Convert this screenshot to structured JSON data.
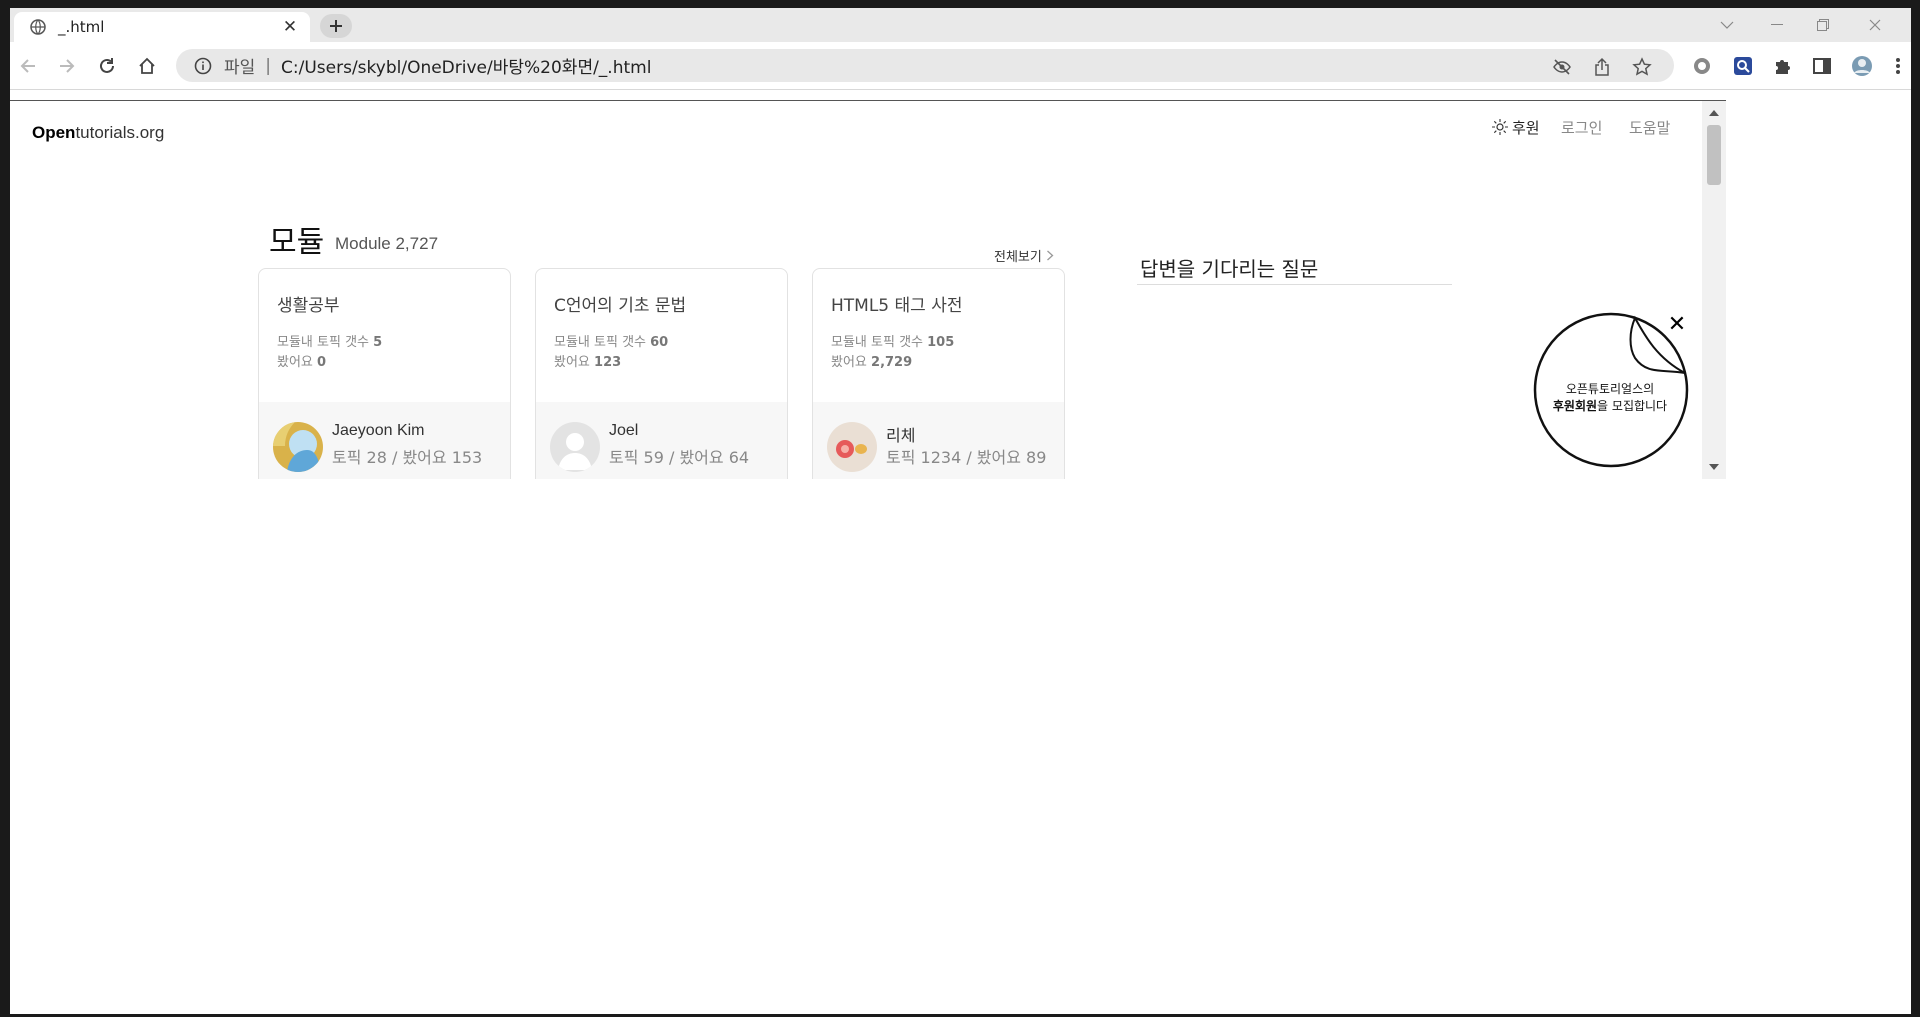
{
  "browser": {
    "tab_title": "_.html",
    "omnibox": {
      "scheme_label": "파일",
      "separator": "|",
      "url": "C:/Users/skybl/OneDrive/바탕%20화면/_.html"
    }
  },
  "page": {
    "logo": {
      "bold": "Open",
      "rest": "tutorials.org"
    },
    "nav": {
      "support": "후원",
      "login": "로그인",
      "help": "도움말"
    },
    "modules": {
      "title": "모듈",
      "subtitle": "Module 2,727",
      "view_all": "전체보기",
      "cards": [
        {
          "title": "생활공부",
          "topics_label": "모듈내 토픽 갯수",
          "topics": "5",
          "seen_label": "봤어요",
          "seen": "0",
          "author": "Jaeyoon Kim",
          "author_stats": "토픽 28 / 봤어요 153"
        },
        {
          "title": "C언어의 기초 문법",
          "topics_label": "모듈내 토픽 갯수",
          "topics": "60",
          "seen_label": "봤어요",
          "seen": "123",
          "author": "Joel",
          "author_stats": "토픽 59 / 봤어요 64"
        },
        {
          "title": "HTML5 태그 사전",
          "topics_label": "모듈내 토픽 갯수",
          "topics": "105",
          "seen_label": "봤어요",
          "seen": "2,729",
          "author": "리체",
          "author_stats": "토픽 1234 / 봤어요 89"
        }
      ]
    },
    "questions": {
      "title": "답변을 기다리는 질문"
    },
    "promo": {
      "line1": "오픈튜토리얼스의",
      "line2_bold": "후원회원",
      "line2_rest": "을 모집합니다"
    }
  }
}
